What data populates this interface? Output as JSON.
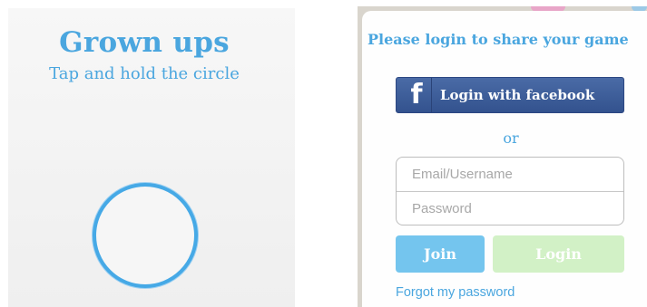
{
  "grown_ups": {
    "title": "Grown ups",
    "subtitle": "Tap and hold the circle",
    "circle_icon": "circle-outline"
  },
  "login_modal": {
    "title": "Please login to share your game",
    "facebook_icon": "f",
    "facebook_button_label": "Login with facebook",
    "or_text": "or",
    "email_placeholder": "Email/Username",
    "email_value": "",
    "password_placeholder": "Password",
    "password_value": "",
    "join_label": "Join",
    "login_label": "Login",
    "forgot_password_label": "Forgot my password"
  },
  "colors": {
    "accent_blue": "#4aa6df",
    "facebook_blue": "#3b5998",
    "join_blue": "#74c5ee",
    "login_green_disabled": "#d2f1c6"
  }
}
